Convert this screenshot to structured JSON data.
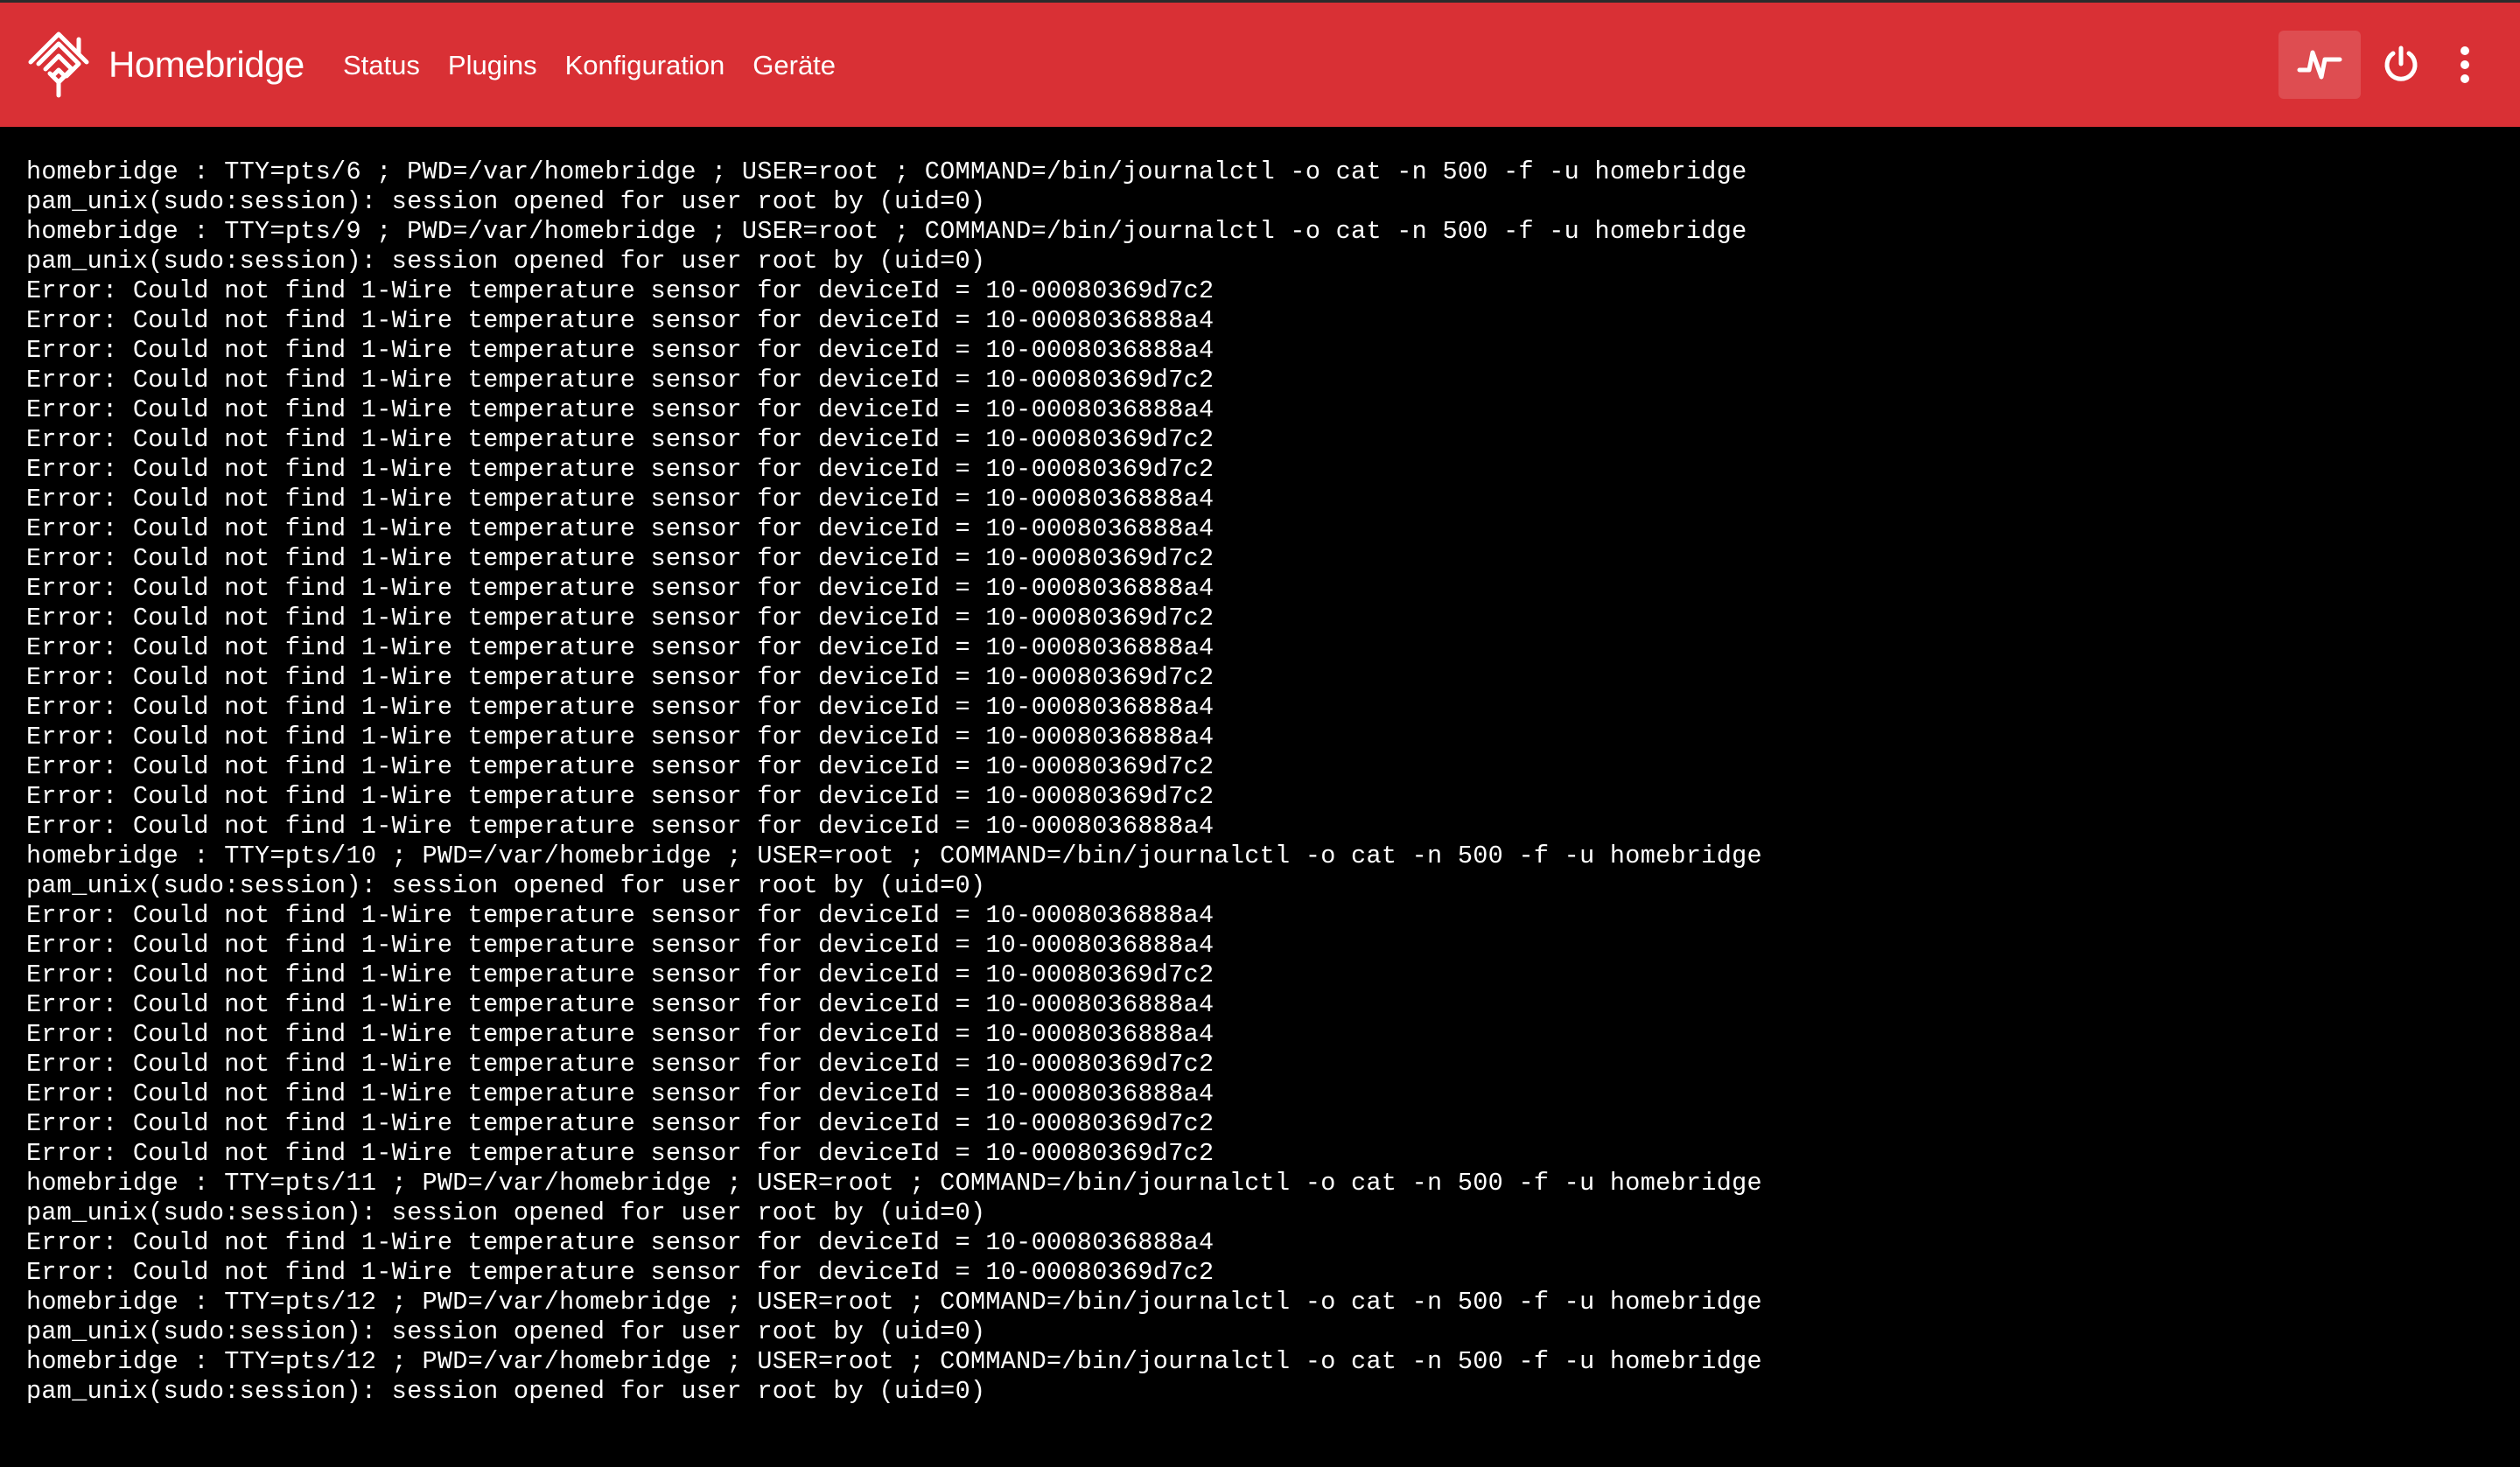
{
  "app": {
    "brand_name": "Homebridge"
  },
  "nav": {
    "items": [
      "Status",
      "Plugins",
      "Konfiguration",
      "Geräte"
    ]
  },
  "actions": {
    "logs_icon": "pulse-icon",
    "power_icon": "power-icon",
    "menu_icon": "more-vertical-icon"
  },
  "colors": {
    "navbar": "#d93035",
    "terminal_bg": "#000000",
    "terminal_text": "#ffffff"
  },
  "terminal": {
    "lines": [
      "homebridge : TTY=pts/6 ; PWD=/var/homebridge ; USER=root ; COMMAND=/bin/journalctl -o cat -n 500 -f -u homebridge",
      "pam_unix(sudo:session): session opened for user root by (uid=0)",
      "homebridge : TTY=pts/9 ; PWD=/var/homebridge ; USER=root ; COMMAND=/bin/journalctl -o cat -n 500 -f -u homebridge",
      "pam_unix(sudo:session): session opened for user root by (uid=0)",
      "Error: Could not find 1-Wire temperature sensor for deviceId = 10-00080369d7c2",
      "Error: Could not find 1-Wire temperature sensor for deviceId = 10-0008036888a4",
      "Error: Could not find 1-Wire temperature sensor for deviceId = 10-0008036888a4",
      "Error: Could not find 1-Wire temperature sensor for deviceId = 10-00080369d7c2",
      "Error: Could not find 1-Wire temperature sensor for deviceId = 10-0008036888a4",
      "Error: Could not find 1-Wire temperature sensor for deviceId = 10-00080369d7c2",
      "Error: Could not find 1-Wire temperature sensor for deviceId = 10-00080369d7c2",
      "Error: Could not find 1-Wire temperature sensor for deviceId = 10-0008036888a4",
      "Error: Could not find 1-Wire temperature sensor for deviceId = 10-0008036888a4",
      "Error: Could not find 1-Wire temperature sensor for deviceId = 10-00080369d7c2",
      "Error: Could not find 1-Wire temperature sensor for deviceId = 10-0008036888a4",
      "Error: Could not find 1-Wire temperature sensor for deviceId = 10-00080369d7c2",
      "Error: Could not find 1-Wire temperature sensor for deviceId = 10-0008036888a4",
      "Error: Could not find 1-Wire temperature sensor for deviceId = 10-00080369d7c2",
      "Error: Could not find 1-Wire temperature sensor for deviceId = 10-0008036888a4",
      "Error: Could not find 1-Wire temperature sensor for deviceId = 10-0008036888a4",
      "Error: Could not find 1-Wire temperature sensor for deviceId = 10-00080369d7c2",
      "Error: Could not find 1-Wire temperature sensor for deviceId = 10-00080369d7c2",
      "Error: Could not find 1-Wire temperature sensor for deviceId = 10-0008036888a4",
      "homebridge : TTY=pts/10 ; PWD=/var/homebridge ; USER=root ; COMMAND=/bin/journalctl -o cat -n 500 -f -u homebridge",
      "pam_unix(sudo:session): session opened for user root by (uid=0)",
      "Error: Could not find 1-Wire temperature sensor for deviceId = 10-0008036888a4",
      "Error: Could not find 1-Wire temperature sensor for deviceId = 10-0008036888a4",
      "Error: Could not find 1-Wire temperature sensor for deviceId = 10-00080369d7c2",
      "Error: Could not find 1-Wire temperature sensor for deviceId = 10-0008036888a4",
      "Error: Could not find 1-Wire temperature sensor for deviceId = 10-0008036888a4",
      "Error: Could not find 1-Wire temperature sensor for deviceId = 10-00080369d7c2",
      "Error: Could not find 1-Wire temperature sensor for deviceId = 10-0008036888a4",
      "Error: Could not find 1-Wire temperature sensor for deviceId = 10-00080369d7c2",
      "Error: Could not find 1-Wire temperature sensor for deviceId = 10-00080369d7c2",
      "homebridge : TTY=pts/11 ; PWD=/var/homebridge ; USER=root ; COMMAND=/bin/journalctl -o cat -n 500 -f -u homebridge",
      "pam_unix(sudo:session): session opened for user root by (uid=0)",
      "Error: Could not find 1-Wire temperature sensor for deviceId = 10-0008036888a4",
      "Error: Could not find 1-Wire temperature sensor for deviceId = 10-00080369d7c2",
      "homebridge : TTY=pts/12 ; PWD=/var/homebridge ; USER=root ; COMMAND=/bin/journalctl -o cat -n 500 -f -u homebridge",
      "pam_unix(sudo:session): session opened for user root by (uid=0)",
      "homebridge : TTY=pts/12 ; PWD=/var/homebridge ; USER=root ; COMMAND=/bin/journalctl -o cat -n 500 -f -u homebridge",
      "pam_unix(sudo:session): session opened for user root by (uid=0)"
    ]
  }
}
